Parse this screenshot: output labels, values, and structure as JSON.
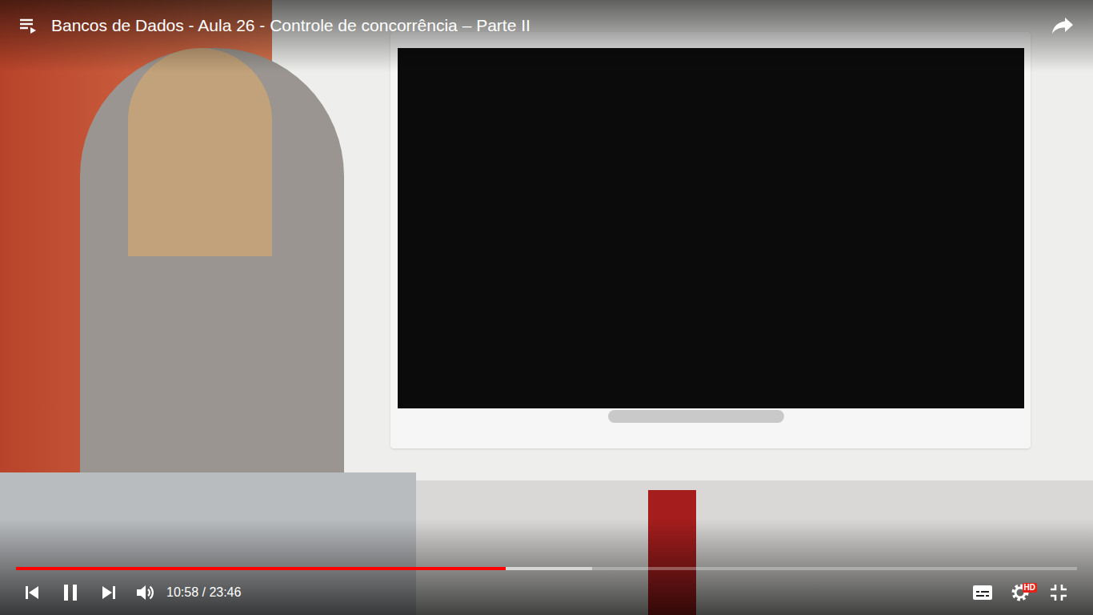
{
  "player": {
    "title": "Bancos de Dados - Aula 26 - Controle de concorrência – Parte II",
    "time": "10:58 / 23:46",
    "playing": true,
    "progress": {
      "level": 0.4614,
      "buffered": 0.543
    },
    "quality_badge": "HD"
  }
}
